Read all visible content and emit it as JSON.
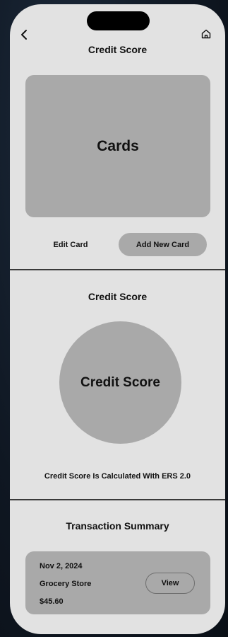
{
  "header": {
    "title": "Credit Score",
    "back_icon": "chevron-left-icon",
    "home_icon": "home-icon"
  },
  "cards": {
    "placeholder_label": "Cards",
    "edit_label": "Edit Card",
    "add_label": "Add New Card"
  },
  "credit_score": {
    "section_title": "Credit Score",
    "circle_label": "Credit Score",
    "note": "Credit Score Is Calculated With ERS 2.0"
  },
  "transactions": {
    "section_title": "Transaction Summary",
    "items": [
      {
        "date": "Nov 2, 2024",
        "merchant": "Grocery Store",
        "amount": "$45.60",
        "view_label": "View"
      }
    ]
  },
  "colors": {
    "screen_bg": "#e2e2e2",
    "placeholder_gray": "#a9a9a9",
    "divider": "#3a3a3a",
    "text": "#111111"
  }
}
